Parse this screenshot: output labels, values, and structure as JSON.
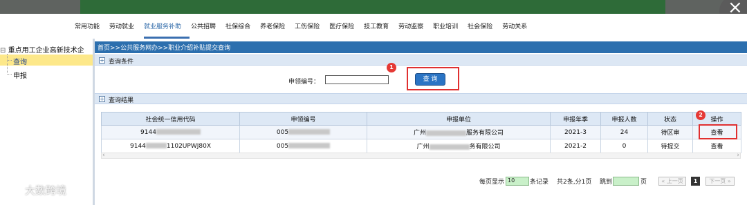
{
  "nav": {
    "items": [
      "常用功能",
      "劳动就业",
      "就业服务补助",
      "公共招聘",
      "社保综合",
      "养老保险",
      "工伤保险",
      "医疗保险",
      "技工教育",
      "劳动监察",
      "职业培训",
      "社会保险",
      "劳动关系"
    ],
    "active_index": 2
  },
  "tree": {
    "root": "重点用工企业高新技术企",
    "items": [
      "查询",
      "申报"
    ],
    "selected_index": 0
  },
  "breadcrumb": "首页>>公共服务网办>>职业介绍补贴提交查询",
  "query_section": {
    "title": "查询条件",
    "field_label": "申领编号：",
    "field_value": "",
    "button_label": "查 询"
  },
  "result_section": {
    "title": "查询结果",
    "columns": [
      "社会统一信用代码",
      "申领编号",
      "申报单位",
      "申报年季",
      "申报人数",
      "状态",
      "操作"
    ],
    "rows": [
      {
        "code": "9144",
        "code_tail": "",
        "apply_no": "005",
        "unit_pre": "广州",
        "unit_post": "服务有限公司",
        "period": "2021-3",
        "count": "24",
        "status": "待区审",
        "action": "查看"
      },
      {
        "code": "9144",
        "code_tail": "1102UPWJ80X",
        "apply_no": "005",
        "unit_pre": "广州",
        "unit_post": "务有限公司",
        "period": "2021-2",
        "count": "0",
        "status": "待提交",
        "action": "查看"
      }
    ]
  },
  "badges": {
    "b1": "1",
    "b2": "2"
  },
  "pager": {
    "per_page_prefix": "每页显示",
    "per_page_value": "10",
    "per_page_suffix": "条记录",
    "summary": "共2条,分1页",
    "jump_label": "跳到",
    "jump_value": "",
    "page_suffix": "页",
    "prev": "« 上一页",
    "current": "1",
    "next": "下一页 »"
  },
  "watermark": "大数跨境",
  "close_symbol": "×"
}
